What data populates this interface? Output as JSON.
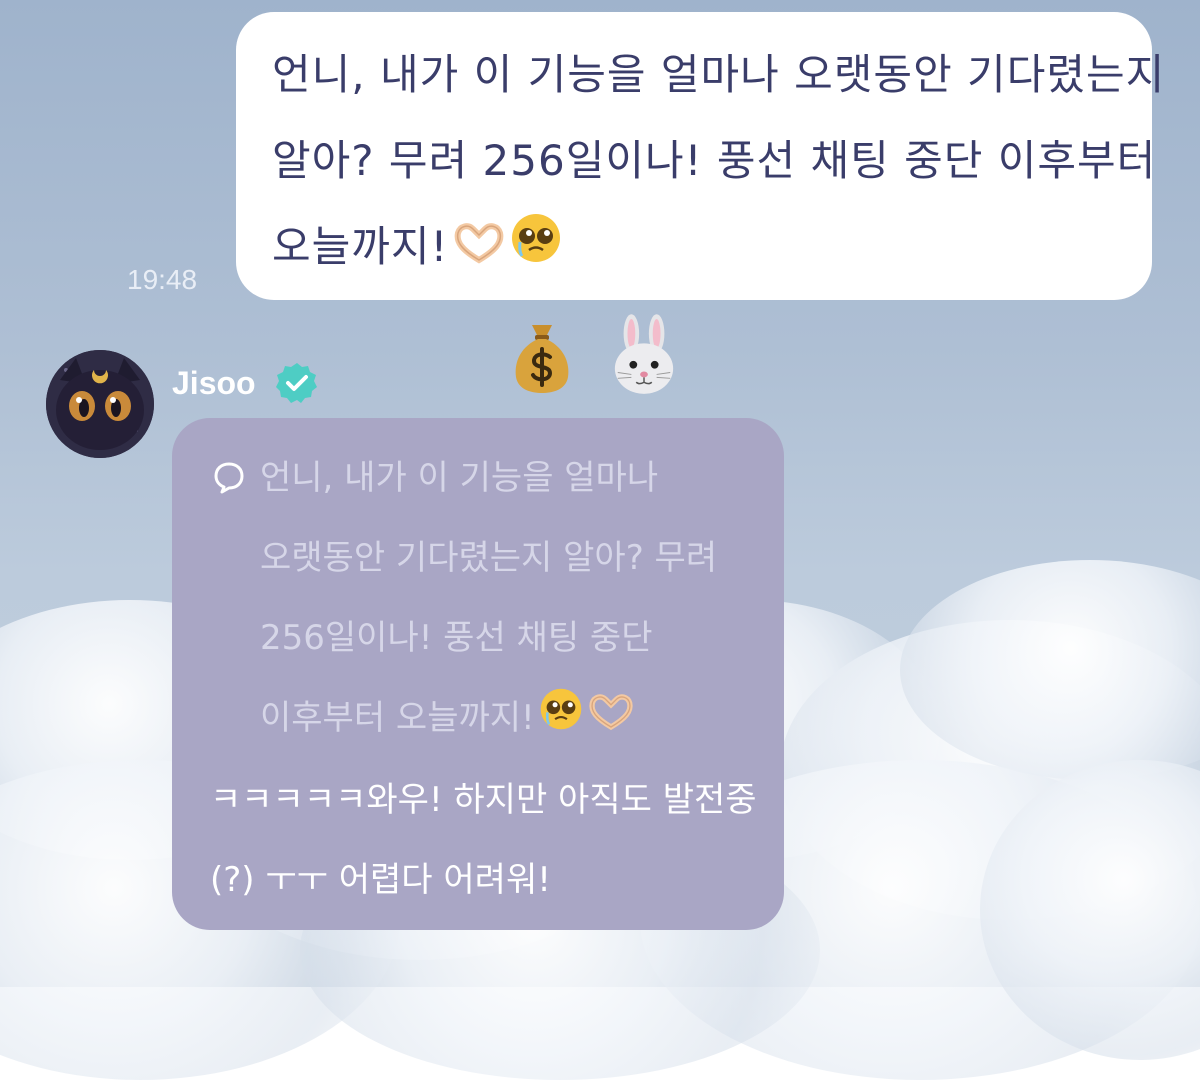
{
  "outgoing_message": {
    "lines": [
      "언니, 내가 이 기능을 얼마나 오랫동안 기다렸는지",
      "알아? 무려 256일이나! 풍선 채팅 중단 이후부터",
      "오늘까지!"
    ],
    "emojis": [
      "heart-hands-emoji",
      "pleading-face-emoji"
    ],
    "timestamp": "19:48"
  },
  "reactions": [
    "money-bag-emoji",
    "rabbit-face-emoji"
  ],
  "incoming_message": {
    "sender_name": "Jisoo",
    "verified": true,
    "quoted_lines": [
      "언니, 내가 이 기능을 얼마나",
      "오랫동안 기다렸는지 알아? 무려",
      "256일이나! 풍선 채팅 중단",
      "이후부터 오늘까지!"
    ],
    "quoted_emojis": [
      "pleading-face-emoji",
      "heart-hands-emoji"
    ],
    "reply_lines": [
      "ㅋㅋㅋㅋㅋ와우! 하지만 아직도 발전중",
      "(?) ㅜㅜ 어렵다 어려워!"
    ]
  },
  "colors": {
    "outgoing_bubble": "#ffffff",
    "outgoing_text": "#3a3d6a",
    "incoming_bubble": "#a9a6c5",
    "quoted_text": "#d6d6e8",
    "reply_text": "#ffffff",
    "verified_badge": "#4ecdc4"
  }
}
